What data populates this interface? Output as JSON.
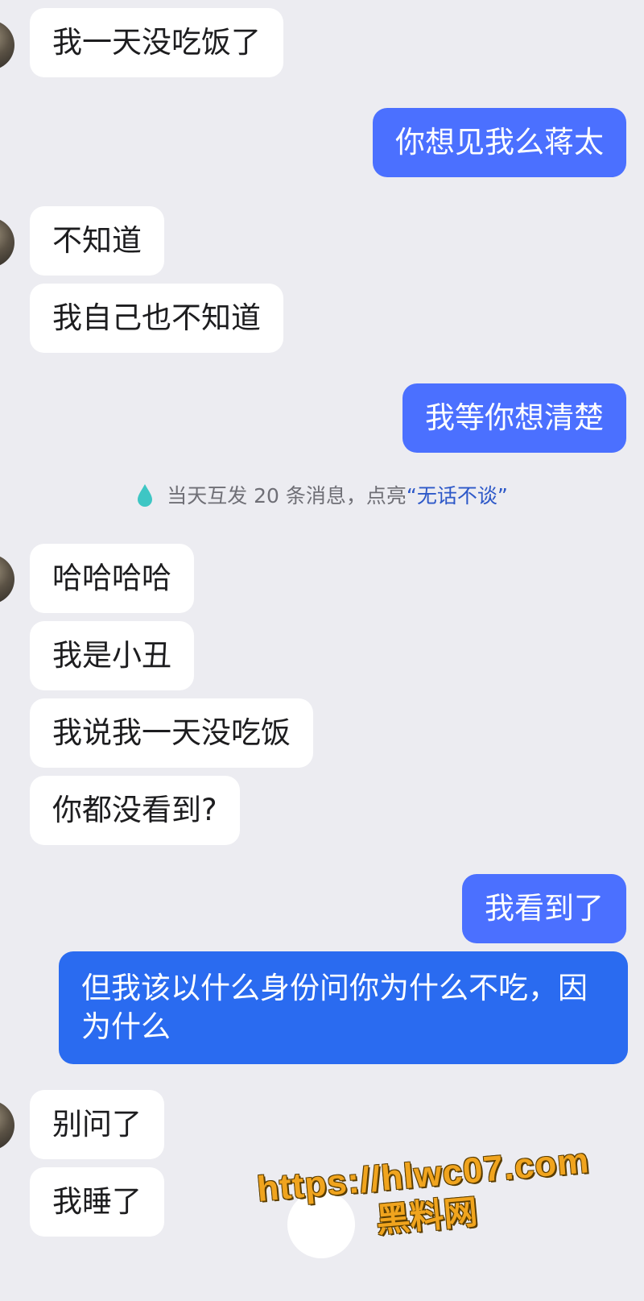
{
  "colors": {
    "background": "#ececf1",
    "incoming_bubble": "#ffffff",
    "outgoing_bubble": "#4b70ff",
    "notice_highlight": "#2d58c8",
    "notice_icon": "#3ec6c4",
    "watermark": "#f0a41e"
  },
  "messages": [
    {
      "side": "in",
      "text": "我一天没吃饭了"
    },
    {
      "side": "out",
      "text": "你想见我么蒋太"
    },
    {
      "side": "in",
      "text": "不知道"
    },
    {
      "side": "in",
      "text": "我自己也不知道"
    },
    {
      "side": "out",
      "text": "我等你想清楚"
    },
    {
      "side": "in",
      "text": "哈哈哈哈"
    },
    {
      "side": "in",
      "text": "我是小丑"
    },
    {
      "side": "in",
      "text": "我说我一天没吃饭"
    },
    {
      "side": "in",
      "text": "你都没看到?"
    },
    {
      "side": "out",
      "text": "我看到了"
    },
    {
      "side": "out",
      "text": "但我该以什么身份问你为什么不吃，因为什么"
    },
    {
      "side": "in",
      "text": "别问了"
    },
    {
      "side": "in",
      "text": "我睡了"
    }
  ],
  "notice": {
    "icon": "drop-icon",
    "prefix": "当天互发 20 条消息，点亮",
    "highlight": "“无话不谈”"
  },
  "watermark": {
    "url": "https://hlwc07.com",
    "label": "黑料网"
  }
}
